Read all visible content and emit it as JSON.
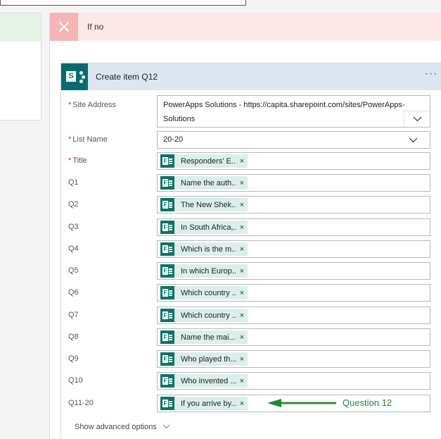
{
  "if_no": {
    "label": "If no"
  },
  "card": {
    "title": "Create item Q12",
    "more": "···"
  },
  "fields": {
    "site_address": {
      "label": "Site Address",
      "value_line1": "PowerApps Solutions - https://capita.sharepoint.com/sites/PowerApps-",
      "value_line2": "Solutions"
    },
    "list_name": {
      "label": "List Name",
      "value": "20-20"
    },
    "title": {
      "label": "Title",
      "token": "Responders' E..."
    },
    "questions": [
      {
        "label": "Q1",
        "token": "Name the auth..."
      },
      {
        "label": "Q2",
        "token": "The New Shek..."
      },
      {
        "label": "Q3",
        "token": "In South Africa,..."
      },
      {
        "label": "Q4",
        "token": "Which is the m..."
      },
      {
        "label": "Q5",
        "token": "In which Europ..."
      },
      {
        "label": "Q6",
        "token": "Which country ..."
      },
      {
        "label": "Q7",
        "token": "Which country ..."
      },
      {
        "label": "Q8",
        "token": "Name the mai..."
      },
      {
        "label": "Q9",
        "token": "Who played th..."
      },
      {
        "label": "Q10",
        "token": "Who invented ..."
      },
      {
        "label": "Q11-20",
        "token": "If you arrive by..."
      }
    ]
  },
  "token_remove": "×",
  "annotation": {
    "text": "Question 12",
    "color": "#1e8a32"
  },
  "advanced": {
    "label": "Show advanced options"
  },
  "colors": {
    "forms_green": "#077568",
    "sharepoint_teal": "#036c70",
    "header_blue": "#dce6f0",
    "if_no_pink": "#fde7e7"
  }
}
